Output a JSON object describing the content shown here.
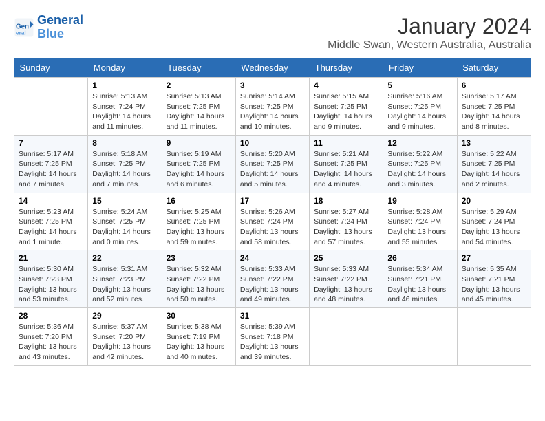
{
  "header": {
    "logo_line1": "General",
    "logo_line2": "Blue",
    "month_title": "January 2024",
    "location": "Middle Swan, Western Australia, Australia"
  },
  "weekdays": [
    "Sunday",
    "Monday",
    "Tuesday",
    "Wednesday",
    "Thursday",
    "Friday",
    "Saturday"
  ],
  "weeks": [
    [
      {
        "day": "",
        "info": ""
      },
      {
        "day": "1",
        "info": "Sunrise: 5:13 AM\nSunset: 7:24 PM\nDaylight: 14 hours\nand 11 minutes."
      },
      {
        "day": "2",
        "info": "Sunrise: 5:13 AM\nSunset: 7:25 PM\nDaylight: 14 hours\nand 11 minutes."
      },
      {
        "day": "3",
        "info": "Sunrise: 5:14 AM\nSunset: 7:25 PM\nDaylight: 14 hours\nand 10 minutes."
      },
      {
        "day": "4",
        "info": "Sunrise: 5:15 AM\nSunset: 7:25 PM\nDaylight: 14 hours\nand 9 minutes."
      },
      {
        "day": "5",
        "info": "Sunrise: 5:16 AM\nSunset: 7:25 PM\nDaylight: 14 hours\nand 9 minutes."
      },
      {
        "day": "6",
        "info": "Sunrise: 5:17 AM\nSunset: 7:25 PM\nDaylight: 14 hours\nand 8 minutes."
      }
    ],
    [
      {
        "day": "7",
        "info": "Sunrise: 5:17 AM\nSunset: 7:25 PM\nDaylight: 14 hours\nand 7 minutes."
      },
      {
        "day": "8",
        "info": "Sunrise: 5:18 AM\nSunset: 7:25 PM\nDaylight: 14 hours\nand 7 minutes."
      },
      {
        "day": "9",
        "info": "Sunrise: 5:19 AM\nSunset: 7:25 PM\nDaylight: 14 hours\nand 6 minutes."
      },
      {
        "day": "10",
        "info": "Sunrise: 5:20 AM\nSunset: 7:25 PM\nDaylight: 14 hours\nand 5 minutes."
      },
      {
        "day": "11",
        "info": "Sunrise: 5:21 AM\nSunset: 7:25 PM\nDaylight: 14 hours\nand 4 minutes."
      },
      {
        "day": "12",
        "info": "Sunrise: 5:22 AM\nSunset: 7:25 PM\nDaylight: 14 hours\nand 3 minutes."
      },
      {
        "day": "13",
        "info": "Sunrise: 5:22 AM\nSunset: 7:25 PM\nDaylight: 14 hours\nand 2 minutes."
      }
    ],
    [
      {
        "day": "14",
        "info": "Sunrise: 5:23 AM\nSunset: 7:25 PM\nDaylight: 14 hours\nand 1 minute."
      },
      {
        "day": "15",
        "info": "Sunrise: 5:24 AM\nSunset: 7:25 PM\nDaylight: 14 hours\nand 0 minutes."
      },
      {
        "day": "16",
        "info": "Sunrise: 5:25 AM\nSunset: 7:25 PM\nDaylight: 13 hours\nand 59 minutes."
      },
      {
        "day": "17",
        "info": "Sunrise: 5:26 AM\nSunset: 7:24 PM\nDaylight: 13 hours\nand 58 minutes."
      },
      {
        "day": "18",
        "info": "Sunrise: 5:27 AM\nSunset: 7:24 PM\nDaylight: 13 hours\nand 57 minutes."
      },
      {
        "day": "19",
        "info": "Sunrise: 5:28 AM\nSunset: 7:24 PM\nDaylight: 13 hours\nand 55 minutes."
      },
      {
        "day": "20",
        "info": "Sunrise: 5:29 AM\nSunset: 7:24 PM\nDaylight: 13 hours\nand 54 minutes."
      }
    ],
    [
      {
        "day": "21",
        "info": "Sunrise: 5:30 AM\nSunset: 7:23 PM\nDaylight: 13 hours\nand 53 minutes."
      },
      {
        "day": "22",
        "info": "Sunrise: 5:31 AM\nSunset: 7:23 PM\nDaylight: 13 hours\nand 52 minutes."
      },
      {
        "day": "23",
        "info": "Sunrise: 5:32 AM\nSunset: 7:22 PM\nDaylight: 13 hours\nand 50 minutes."
      },
      {
        "day": "24",
        "info": "Sunrise: 5:33 AM\nSunset: 7:22 PM\nDaylight: 13 hours\nand 49 minutes."
      },
      {
        "day": "25",
        "info": "Sunrise: 5:33 AM\nSunset: 7:22 PM\nDaylight: 13 hours\nand 48 minutes."
      },
      {
        "day": "26",
        "info": "Sunrise: 5:34 AM\nSunset: 7:21 PM\nDaylight: 13 hours\nand 46 minutes."
      },
      {
        "day": "27",
        "info": "Sunrise: 5:35 AM\nSunset: 7:21 PM\nDaylight: 13 hours\nand 45 minutes."
      }
    ],
    [
      {
        "day": "28",
        "info": "Sunrise: 5:36 AM\nSunset: 7:20 PM\nDaylight: 13 hours\nand 43 minutes."
      },
      {
        "day": "29",
        "info": "Sunrise: 5:37 AM\nSunset: 7:20 PM\nDaylight: 13 hours\nand 42 minutes."
      },
      {
        "day": "30",
        "info": "Sunrise: 5:38 AM\nSunset: 7:19 PM\nDaylight: 13 hours\nand 40 minutes."
      },
      {
        "day": "31",
        "info": "Sunrise: 5:39 AM\nSunset: 7:18 PM\nDaylight: 13 hours\nand 39 minutes."
      },
      {
        "day": "",
        "info": ""
      },
      {
        "day": "",
        "info": ""
      },
      {
        "day": "",
        "info": ""
      }
    ]
  ]
}
